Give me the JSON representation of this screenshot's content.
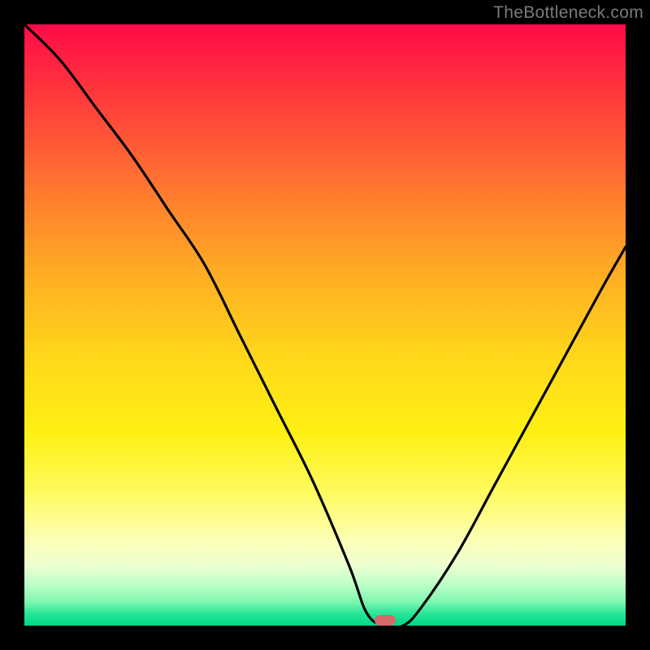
{
  "watermark": "TheBottleneck.com",
  "marker": {
    "cx_pct": 60,
    "cy_pct": 99
  },
  "colors": {
    "frame": "#000000",
    "curve": "#000000",
    "marker": "#d46a6a"
  },
  "chart_data": {
    "type": "line",
    "title": "",
    "xlabel": "",
    "ylabel": "",
    "xlim": [
      0,
      100
    ],
    "ylim": [
      0,
      100
    ],
    "x": [
      0,
      6,
      12,
      18,
      24,
      30,
      36,
      42,
      48,
      54,
      57,
      60,
      63,
      66,
      72,
      78,
      84,
      90,
      96,
      100
    ],
    "values": [
      100,
      94,
      86,
      78,
      69,
      60,
      48,
      36,
      24,
      10,
      2,
      0,
      0,
      3,
      12,
      23,
      34,
      45,
      56,
      63
    ],
    "grid": false,
    "legend": false,
    "series": [
      {
        "name": "bottleneck-curve",
        "x_key": "x",
        "y_key": "values"
      }
    ],
    "annotations": [
      {
        "type": "marker",
        "x": 60,
        "y": 0,
        "label": ""
      }
    ]
  }
}
